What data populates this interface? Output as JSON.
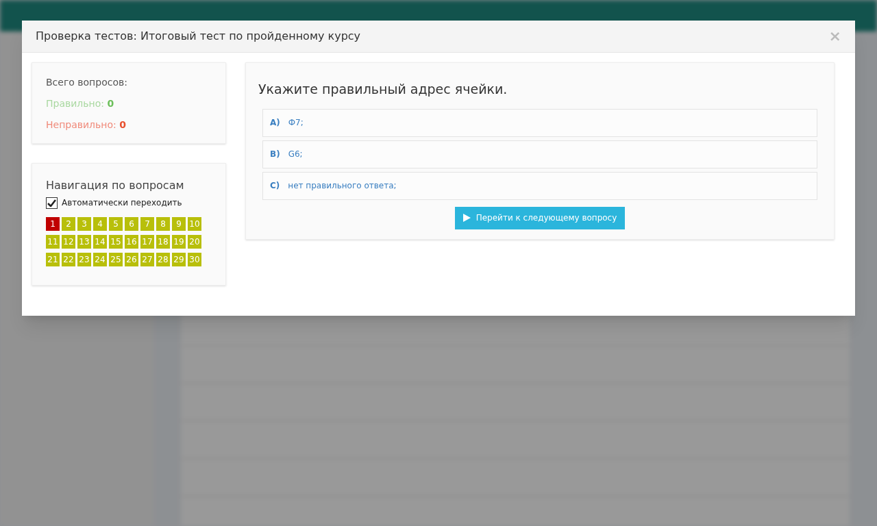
{
  "dialog": {
    "title": "Проверка тестов: Итоговый тест по пройденному курсу",
    "close": "×"
  },
  "summary": {
    "total_label": "Всего вопросов:",
    "correct_label": "Правильно:",
    "correct_value": "0",
    "wrong_label": "Неправильно:",
    "wrong_value": "0"
  },
  "navigation": {
    "title": "Навигация по вопросам",
    "auto_advance": {
      "label": "Автоматически переходить",
      "checked": true
    },
    "questions": [
      {
        "label": "1",
        "selected": true
      },
      {
        "label": "2",
        "selected": false
      },
      {
        "label": "3",
        "selected": false
      },
      {
        "label": "4",
        "selected": false
      },
      {
        "label": "5",
        "selected": false
      },
      {
        "label": "6",
        "selected": false
      },
      {
        "label": "7",
        "selected": false
      },
      {
        "label": "8",
        "selected": false
      },
      {
        "label": "9",
        "selected": false
      },
      {
        "label": "10",
        "selected": false
      },
      {
        "label": "11",
        "selected": false
      },
      {
        "label": "12",
        "selected": false
      },
      {
        "label": "13",
        "selected": false
      },
      {
        "label": "14",
        "selected": false
      },
      {
        "label": "15",
        "selected": false
      },
      {
        "label": "16",
        "selected": false
      },
      {
        "label": "17",
        "selected": false
      },
      {
        "label": "18",
        "selected": false
      },
      {
        "label": "19",
        "selected": false
      },
      {
        "label": "20",
        "selected": false
      },
      {
        "label": "21",
        "selected": false
      },
      {
        "label": "22",
        "selected": false
      },
      {
        "label": "23",
        "selected": false
      },
      {
        "label": "24",
        "selected": false
      },
      {
        "label": "25",
        "selected": false
      },
      {
        "label": "26",
        "selected": false
      },
      {
        "label": "27",
        "selected": false
      },
      {
        "label": "28",
        "selected": false
      },
      {
        "label": "29",
        "selected": false
      },
      {
        "label": "30",
        "selected": false
      }
    ]
  },
  "question": {
    "text": "Укажите правильный адрес ячейки.",
    "answers": [
      {
        "letter": "A)",
        "text": "Ф7;"
      },
      {
        "letter": "B)",
        "text": "G6;"
      },
      {
        "letter": "C)",
        "text": "нет правильного ответа;"
      }
    ],
    "next_button": "Перейти к следующему вопросу"
  }
}
